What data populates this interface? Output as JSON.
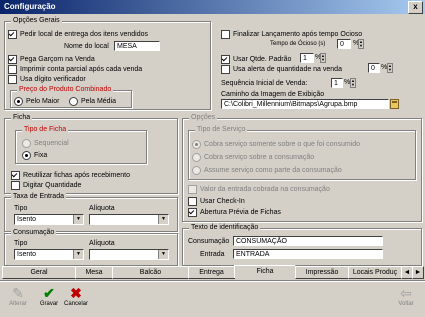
{
  "window": {
    "title": "Configuração",
    "close": "x"
  },
  "opcoes_gerais": {
    "legend": "Opções Gerais",
    "pedir_local": "Pedir local de entrega dos itens vendidos",
    "nome_local_label": "Nome do local",
    "nome_local_value": "MESA",
    "pega_garcom": "Pega Garçom na Venda",
    "imprimir_parcial": "Imprimir conta parcial após cada venda",
    "usa_digito": "Usa dígito verificador",
    "preco_legend": "Preço do Produto Combinado",
    "pelo_maior": "Pelo Maior",
    "pela_media": "Pela Média"
  },
  "right_top": {
    "finalizar": "Finalizar Lançamento após tempo Ocioso",
    "tempo_ocioso_label": "Tempo de Ócioso (s)",
    "tempo_ocioso_value": "0",
    "tempo_ocioso_unit": "%",
    "usar_qtde": "Usar Qtde. Padrão",
    "qtde_value": "1",
    "qtde_unit": "%",
    "usa_alerta": "Usa alerta de quantidade na venda",
    "alerta_value": "0",
    "alerta_unit": "%",
    "seq_label": "Sequência Inicial de Venda:",
    "seq_value": "1",
    "seq_unit": "%",
    "caminho_label": "Caminho da Imagem de Exibição",
    "caminho_value": "C:\\Colibri_Millennium\\Bitmaps\\Agrupa.bmp"
  },
  "ficha": {
    "legend": "Ficha",
    "tipo_legend": "Tipo de Ficha",
    "sequencial": "Sequencial",
    "fixa": "Fixa",
    "reutilizar": "Reutilizar fichas após recebimento",
    "digitar_qtd": "Digitar Quantidade"
  },
  "opcoes": {
    "legend": "Opções",
    "tipo_servico_legend": "Tipo de Serviço",
    "cobra_somente": "Cobra serviço somente sobre o que foi consumido",
    "cobra_consumacao": "Cobra serviço sobre a consumação",
    "assume_servico": "Assume serviço como parte da consumação",
    "valor_entrada": "Valor da entrada cobrada na consumação",
    "usar_checkin": "Usar Check-In",
    "abertura_previa": "Abertura Prévia de Fichas"
  },
  "taxa_entrada": {
    "legend": "Taxa de Entrada",
    "tipo_label": "Tipo",
    "aliquota_label": "Alíquota",
    "tipo_value": "Isento",
    "aliquota_value": ""
  },
  "consumacao": {
    "legend": "Consumação",
    "tipo_label": "Tipo",
    "aliquota_label": "Alíquota",
    "tipo_value": "Isento",
    "aliquota_value": ""
  },
  "texto_identificacao": {
    "legend": "Texto de identificação",
    "consumacao_label": "Consumação",
    "consumacao_value": "CONSUMAÇÃO",
    "entrada_label": "Entrada",
    "entrada_value": "ENTRADA"
  },
  "tabs": [
    "Geral",
    "Mesa",
    "Balcão",
    "Entrega",
    "Ficha",
    "Impressão",
    "Locais Produç"
  ],
  "active_tab": "Ficha",
  "toolbar": {
    "alterar": "Alterar",
    "gravar": "Gravar",
    "cancelar": "Cancelar",
    "voltar": "Voltar"
  },
  "colors": {
    "titlebar": "#0a246a",
    "legend_red": "#c00000",
    "face": "#d4d0c8"
  }
}
